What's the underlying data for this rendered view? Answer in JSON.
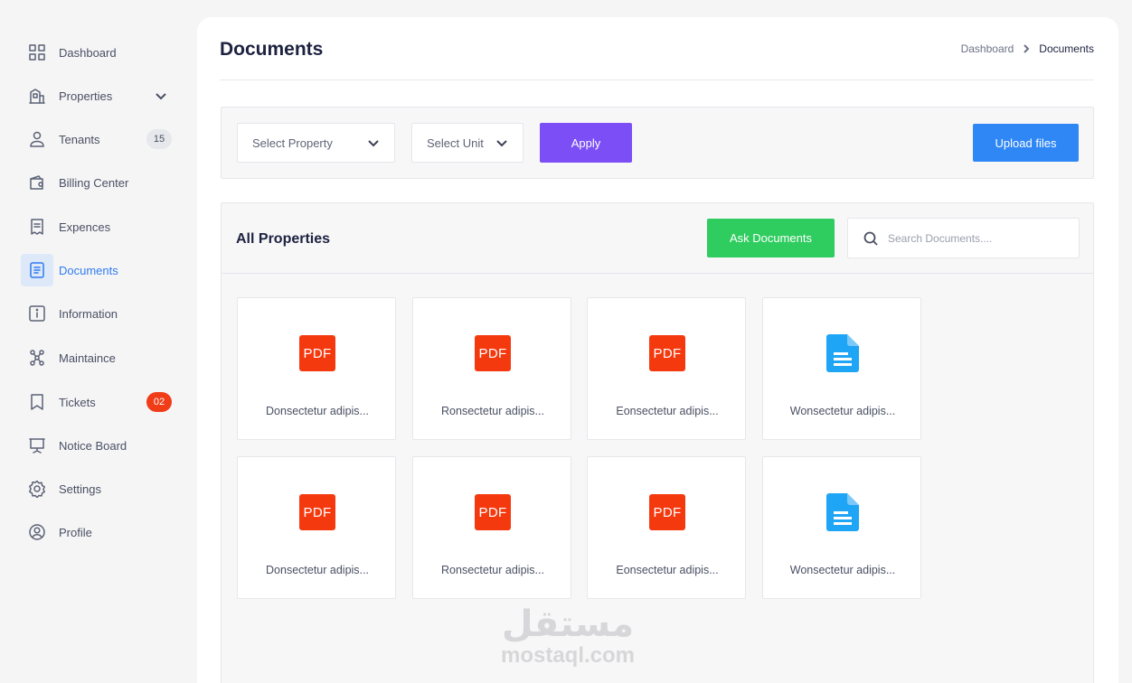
{
  "sidebar": {
    "items": [
      {
        "label": "Dashboard",
        "icon": "grid-icon"
      },
      {
        "label": "Properties",
        "icon": "building-icon",
        "has_chevron": true
      },
      {
        "label": "Tenants",
        "icon": "user-icon",
        "badge": "15"
      },
      {
        "label": "Billing Center",
        "icon": "wallet-icon"
      },
      {
        "label": "Expences",
        "icon": "receipt-icon"
      },
      {
        "label": "Documents",
        "icon": "document-icon",
        "active": true
      },
      {
        "label": "Information",
        "icon": "info-icon"
      },
      {
        "label": "Maintaince",
        "icon": "people-network-icon"
      },
      {
        "label": "Tickets",
        "icon": "bookmark-icon",
        "badge": "02"
      },
      {
        "label": "Notice Board",
        "icon": "board-icon"
      },
      {
        "label": "Settings",
        "icon": "gear-icon"
      },
      {
        "label": "Profile",
        "icon": "profile-icon"
      }
    ]
  },
  "header": {
    "title": "Documents",
    "breadcrumb": {
      "home": "Dashboard",
      "current": "Documents"
    }
  },
  "filters": {
    "property_select": "Select Property",
    "unit_select": "Select Unit",
    "apply_label": "Apply",
    "upload_label": "Upload files"
  },
  "documents_panel": {
    "title": "All Properties",
    "ask_label": "Ask Documents",
    "search_placeholder": "Search Documents....",
    "files": [
      {
        "type": "pdf",
        "badge": "PDF",
        "name": "Donsectetur adipis..."
      },
      {
        "type": "pdf",
        "badge": "PDF",
        "name": "Ronsectetur adipis..."
      },
      {
        "type": "pdf",
        "badge": "PDF",
        "name": "Eonsectetur adipis..."
      },
      {
        "type": "doc",
        "name": "Wonsectetur adipis..."
      },
      {
        "type": "pdf",
        "badge": "PDF",
        "name": "Donsectetur adipis..."
      },
      {
        "type": "pdf",
        "badge": "PDF",
        "name": "Ronsectetur adipis..."
      },
      {
        "type": "pdf",
        "badge": "PDF",
        "name": "Eonsectetur adipis..."
      },
      {
        "type": "doc",
        "name": "Wonsectetur adipis..."
      }
    ]
  },
  "watermark": {
    "logo": "مستقل",
    "text": "mostaql.com"
  },
  "colors": {
    "accent_blue": "#2f7bf0",
    "apply_purple": "#7b4ff5",
    "upload_blue": "#2f87f5",
    "ask_green": "#2fcc5f",
    "pdf_red": "#f5390f",
    "doc_blue": "#1ea5f5",
    "badge_red": "#f03c17"
  }
}
